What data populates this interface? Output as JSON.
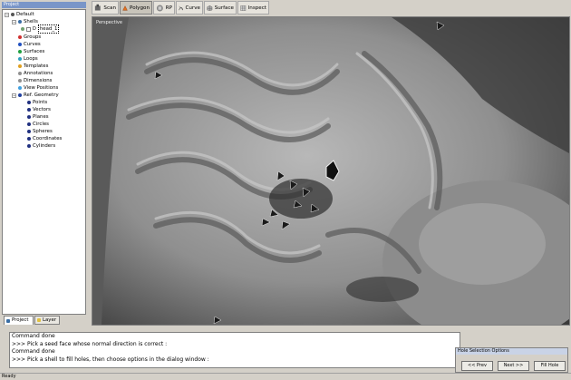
{
  "panel": {
    "title": "Project"
  },
  "tree": [
    {
      "label": "Default",
      "icon": "folder-icon",
      "color": "#555555"
    },
    {
      "label": "Shells",
      "icon": "shell-icon",
      "color": "#3a6ea5"
    },
    {
      "label": "head_1",
      "icon": "mesh-icon",
      "color": "#808080"
    },
    {
      "label": "Groups",
      "icon": "group-icon",
      "color": "#d03030"
    },
    {
      "label": "Curves",
      "icon": "curve-icon",
      "color": "#2050c0"
    },
    {
      "label": "Surfaces",
      "icon": "surface-icon",
      "color": "#20a040"
    },
    {
      "label": "Loops",
      "icon": "loop-icon",
      "color": "#30a0c0"
    },
    {
      "label": "Templates",
      "icon": "template-icon",
      "color": "#e0a020"
    },
    {
      "label": "Annotations",
      "icon": "annotation-icon",
      "color": "#909090"
    },
    {
      "label": "Dimensions",
      "icon": "dimension-icon",
      "color": "#909090"
    },
    {
      "label": "View Positions",
      "icon": "view-icon",
      "color": "#40a0e0"
    },
    {
      "label": "Ref. Geometry",
      "icon": "ref-geometry-icon",
      "color": "#2040a0"
    },
    {
      "label": "Points",
      "icon": "points-icon",
      "color": "#203080"
    },
    {
      "label": "Vectors",
      "icon": "vectors-icon",
      "color": "#203080"
    },
    {
      "label": "Planes",
      "icon": "planes-icon",
      "color": "#203080"
    },
    {
      "label": "Circles",
      "icon": "circles-icon",
      "color": "#203080"
    },
    {
      "label": "Spheres",
      "icon": "spheres-icon",
      "color": "#203080"
    },
    {
      "label": "Coordinates",
      "icon": "coordinates-icon",
      "color": "#203080"
    },
    {
      "label": "Cylinders",
      "icon": "cylinders-icon",
      "color": "#203080"
    }
  ],
  "tabs": [
    {
      "label": "Project",
      "active": true
    },
    {
      "label": "Layer",
      "active": false
    }
  ],
  "toolbar": [
    {
      "label": "Scan",
      "icon": "scan-icon",
      "active": false
    },
    {
      "label": "Polygon",
      "icon": "polygon-icon",
      "active": true
    },
    {
      "label": "RP",
      "icon": "rp-icon",
      "active": false
    },
    {
      "label": "Curve",
      "icon": "curve-icon",
      "active": false
    },
    {
      "label": "Surface",
      "icon": "surface-icon",
      "active": false
    },
    {
      "label": "Inspect",
      "icon": "inspect-icon",
      "active": false
    }
  ],
  "viewport": {
    "label": "Perspective"
  },
  "console": {
    "lines": [
      "Command done",
      ">>> Pick a seed face whose normal direction is correct :",
      "Command done",
      ">>> Pick a shell to fill holes, then choose options in the dialog window :"
    ]
  },
  "hole_dialog": {
    "title": "Hole Selection Options",
    "prev": "<< Prev",
    "next": "Next >>",
    "fill": "Fill Hole"
  },
  "status": {
    "text": "Ready"
  }
}
